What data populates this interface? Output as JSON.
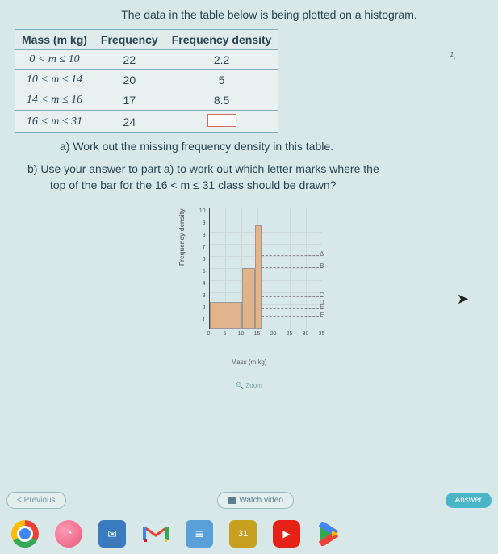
{
  "intro": "The data in the table below is being plotted on a histogram.",
  "table": {
    "headers": [
      "Mass (m kg)",
      "Frequency",
      "Frequency density"
    ],
    "rows": [
      {
        "mass": "0 < m ≤ 10",
        "freq": "22",
        "dens": "2.2"
      },
      {
        "mass": "10 < m ≤ 14",
        "freq": "20",
        "dens": "5"
      },
      {
        "mass": "14 < m ≤ 16",
        "freq": "17",
        "dens": "8.5"
      },
      {
        "mass": "16 < m ≤ 31",
        "freq": "24",
        "dens": ""
      }
    ]
  },
  "question_a": "a) Work out the missing frequency density in this table.",
  "question_b_line1": "b) Use your answer to part a) to work out which letter marks where the",
  "question_b_line2": "top of the bar for the 16 < m ≤ 31 class should be drawn?",
  "chart_data": {
    "type": "bar",
    "title": "",
    "xlabel": "Mass (m kg)",
    "ylabel": "Frequency density",
    "xlim": [
      0,
      35
    ],
    "ylim": [
      0,
      10
    ],
    "xticks": [
      "0",
      "5",
      "10",
      "15",
      "20",
      "25",
      "30",
      "35"
    ],
    "yticks": [
      "1",
      "2",
      "3",
      "4",
      "5",
      "6",
      "7",
      "8",
      "9",
      "10"
    ],
    "bars": [
      {
        "from": 0,
        "to": 10,
        "height": 2.2
      },
      {
        "from": 10,
        "to": 14,
        "height": 5
      },
      {
        "from": 14,
        "to": 16,
        "height": 8.5
      }
    ],
    "answer_letters": [
      {
        "label": "A",
        "y": 6
      },
      {
        "label": "B",
        "y": 5
      },
      {
        "label": "C",
        "y": 2.6
      },
      {
        "label": "D",
        "y": 2
      },
      {
        "label": "E",
        "y": 1.6
      },
      {
        "label": "F",
        "y": 1
      }
    ]
  },
  "zoom": "🔍 Zoom",
  "nav": {
    "prev": "< Previous",
    "watch": "Watch video",
    "answer": "Answer"
  },
  "taskbar": {
    "items": [
      "chrome",
      "assistant",
      "outlook",
      "gmail",
      "tasks",
      "files",
      "youtube",
      "play-store"
    ]
  },
  "scribble": "¹,"
}
